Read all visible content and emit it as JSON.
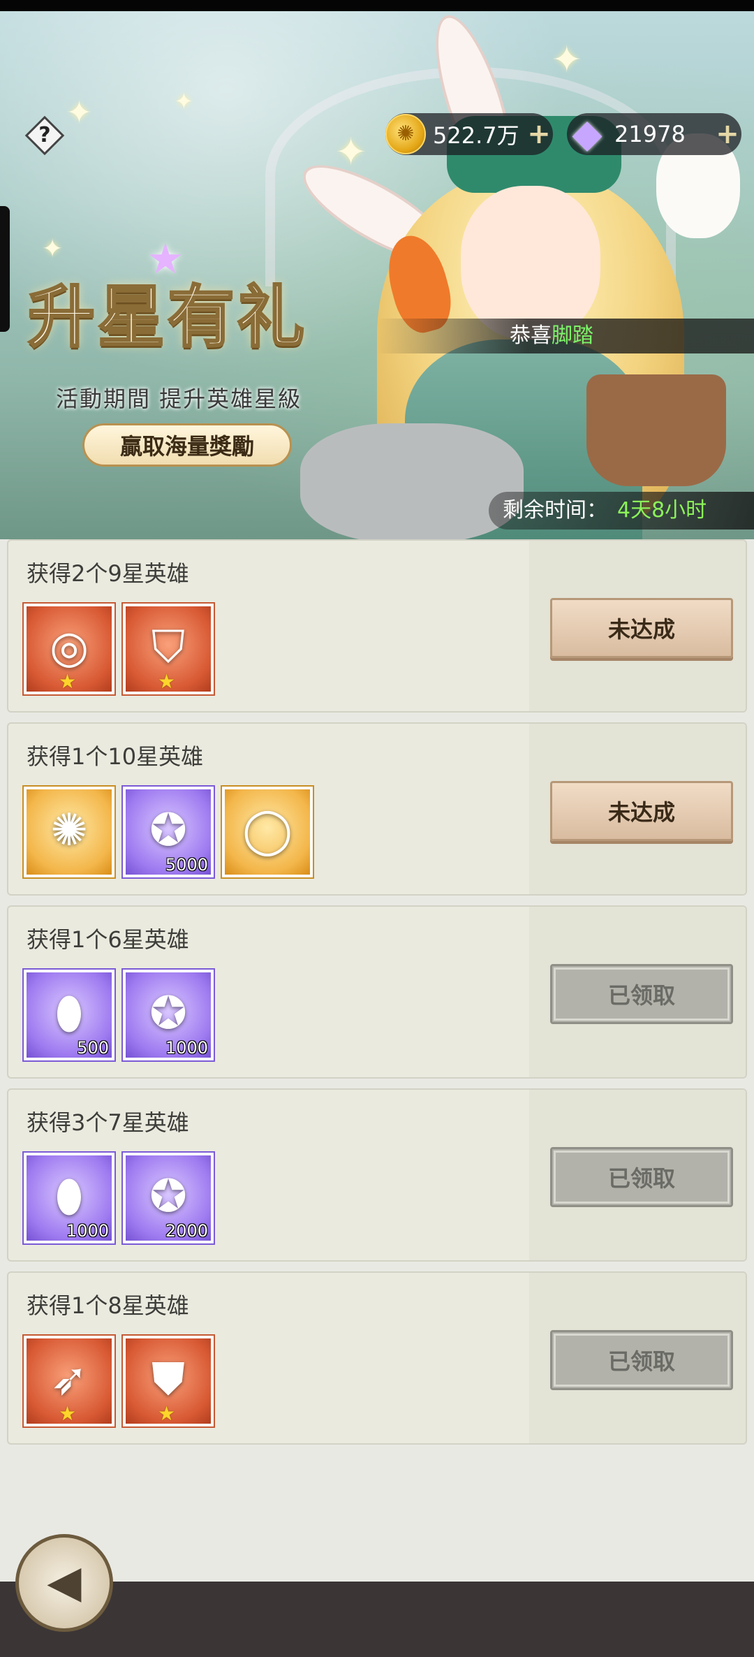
{
  "header": {
    "help_symbol": "?",
    "gold_value": "522.7万",
    "gem_value": "21978",
    "plus_symbol": "+",
    "icons": {
      "gold": "gold-coin-icon",
      "gem": "diamond-gem-icon",
      "help": "help-icon"
    }
  },
  "banner": {
    "title": "升星有礼",
    "subtitle": "活動期間 提升英雄星級",
    "pill": "贏取海量獎勵",
    "congrats_prefix": "恭喜",
    "congrats_name": "脚踏",
    "timer_label": "剩余时间：",
    "timer_value": "4天8小时"
  },
  "tasks": [
    {
      "label": "获得2个9星英雄",
      "button": "未达成",
      "status": "pending",
      "rewards": [
        {
          "icon": "ring-icon",
          "frame": "red",
          "star": "★",
          "qty": ""
        },
        {
          "icon": "armor-icon",
          "frame": "red",
          "star": "★",
          "qty": ""
        }
      ]
    },
    {
      "label": "获得1个10星英雄",
      "button": "未达成",
      "status": "pending",
      "rewards": [
        {
          "icon": "swirl-emblem-icon",
          "frame": "gold",
          "star": "",
          "qty": ""
        },
        {
          "icon": "star-medal-icon",
          "frame": "purple",
          "star": "",
          "qty": "5000"
        },
        {
          "icon": "avatar-frame-icon",
          "frame": "gold",
          "star": "",
          "qty": ""
        }
      ]
    },
    {
      "label": "获得1个6星英雄",
      "button": "已领取",
      "status": "claimed",
      "rewards": [
        {
          "icon": "blue-crystal-icon",
          "frame": "purple",
          "star": "",
          "qty": "500"
        },
        {
          "icon": "star-medal-icon",
          "frame": "purple",
          "star": "",
          "qty": "1000"
        }
      ]
    },
    {
      "label": "获得3个7星英雄",
      "button": "已领取",
      "status": "claimed",
      "rewards": [
        {
          "icon": "blue-crystal-icon",
          "frame": "purple",
          "star": "",
          "qty": "1000"
        },
        {
          "icon": "star-medal-icon",
          "frame": "purple",
          "star": "",
          "qty": "2000"
        }
      ]
    },
    {
      "label": "获得1个8星英雄",
      "button": "已领取",
      "status": "claimed",
      "rewards": [
        {
          "icon": "crossbow-icon",
          "frame": "red",
          "star": "★",
          "qty": ""
        },
        {
          "icon": "chest-armor-icon",
          "frame": "red",
          "star": "★",
          "qty": ""
        }
      ]
    }
  ],
  "footer": {
    "back_icon": "back-arrow-icon"
  }
}
